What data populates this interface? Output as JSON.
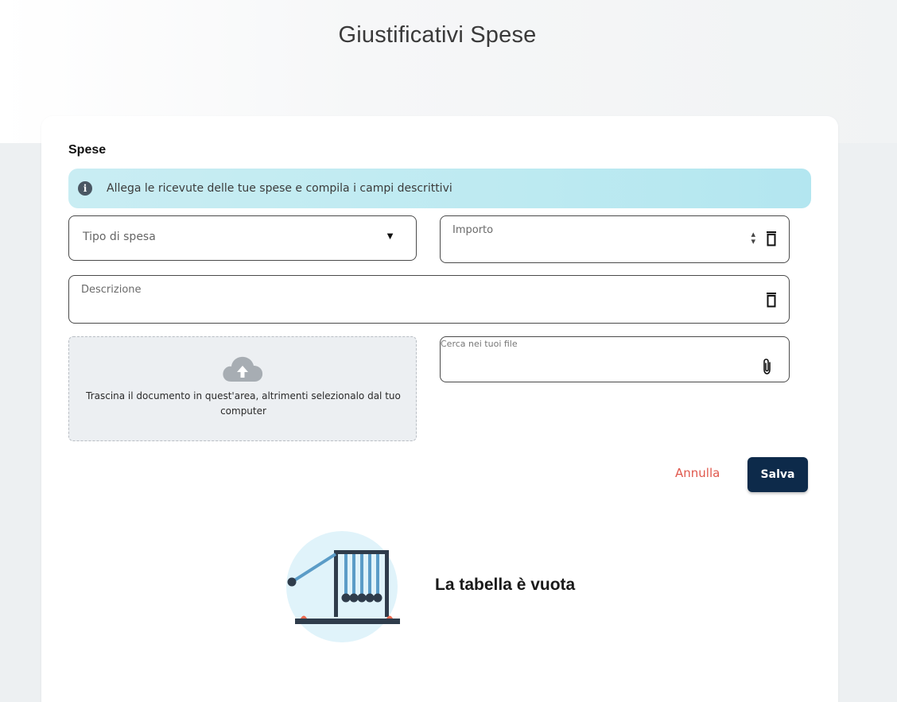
{
  "page": {
    "title": "Giustificativi Spese"
  },
  "section": {
    "title": "Spese"
  },
  "info_banner": {
    "text": "Allega le ricevute delle tue spese e compila i campi descrittivi"
  },
  "form": {
    "expense_type": {
      "placeholder": "Tipo di spesa"
    },
    "amount": {
      "label": "Importo",
      "value": ""
    },
    "description": {
      "label": "Descrizione",
      "value": ""
    },
    "file": {
      "label": "Cerca nei tuoi file"
    }
  },
  "dropzone": {
    "text_line1": "Trascina il documento in quest'area, altrimenti selezionalo dal tuo",
    "text_line2": "computer"
  },
  "actions": {
    "cancel_label": "Annulla",
    "save_label": "Salva"
  },
  "empty_state": {
    "text": "La tabella è vuota"
  },
  "colors": {
    "primary": "#0d2a4a",
    "cancel": "#e0584d",
    "info_bg": "#bdeaf1"
  },
  "icons": [
    "info-icon",
    "chevron-down-icon",
    "spinner-icon",
    "trash-icon",
    "cloud-upload-icon",
    "paperclip-icon",
    "newton-cradle-illustration"
  ]
}
